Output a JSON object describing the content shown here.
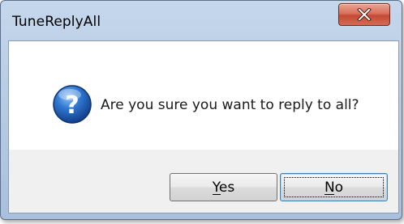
{
  "window": {
    "title": "TuneReplyAll",
    "close_button": "close"
  },
  "dialog": {
    "icon": "question-icon",
    "message": "Are you sure you want to reply to all?"
  },
  "buttons": {
    "yes_label": "Yes",
    "no_label": "No",
    "focused": "No"
  },
  "colors": {
    "frame": "#b7cbe4",
    "close_button": "#d9705c",
    "question_icon": "#1f5fb8",
    "default_button_border": "#3c7fb1"
  }
}
